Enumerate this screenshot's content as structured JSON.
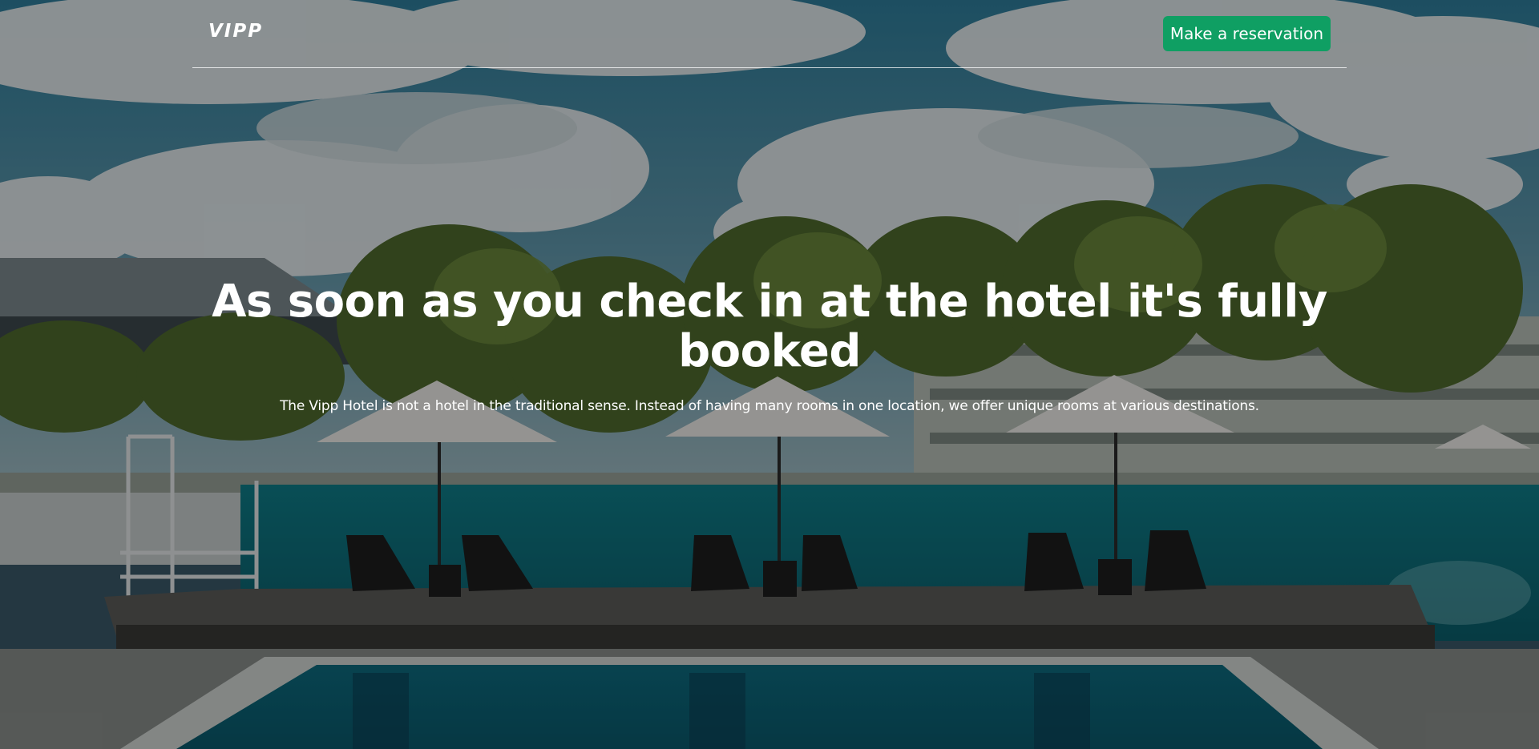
{
  "nav": {
    "logo": "VIPP",
    "reserve_label": "Make a reservation"
  },
  "hero": {
    "headline": "As soon as you check in at the hotel it's fully booked",
    "subtext": "The Vipp Hotel is not a hotel in the traditional sense. Instead of having many rooms in one location, we offer unique rooms at various destinations."
  },
  "colors": {
    "accent": "#0f9f63",
    "text": "#ffffff"
  }
}
